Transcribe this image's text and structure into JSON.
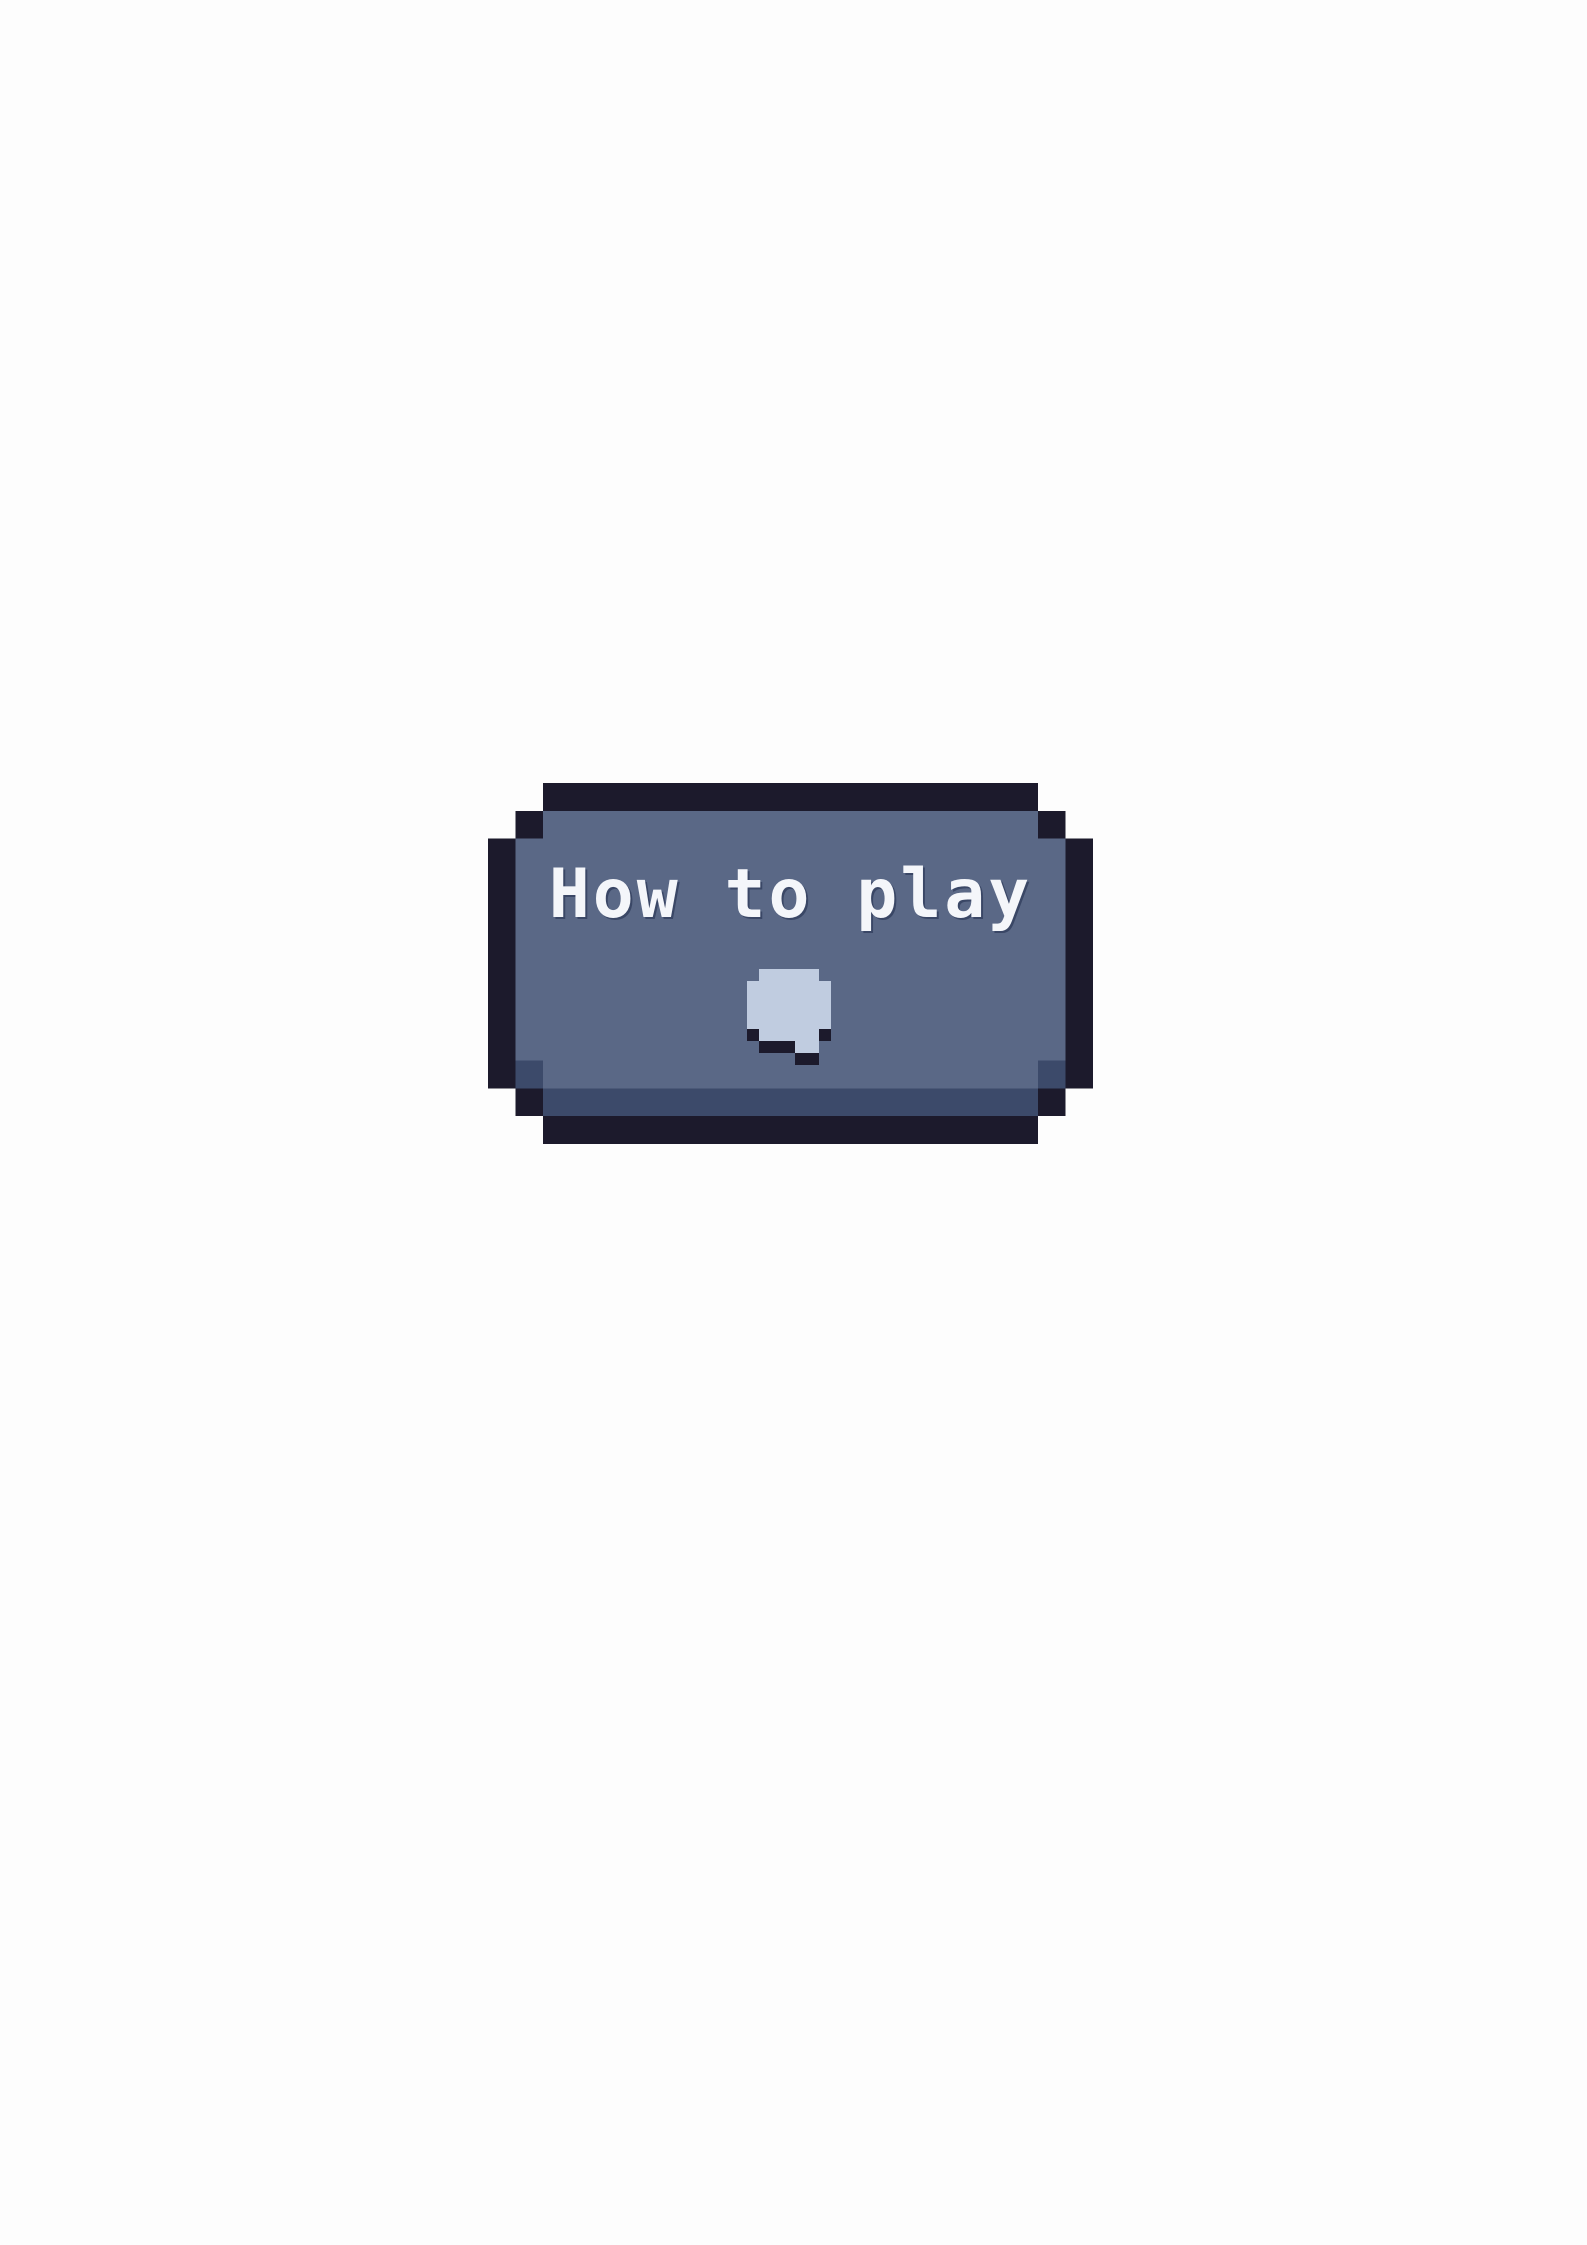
{
  "button": {
    "label": "How to play",
    "icon": "speech-bubble-icon"
  },
  "colors": {
    "page_background": "#fdfdfd",
    "outline": "#1c1a2c",
    "face": "#5a6886",
    "shadow": "#3c4a6a",
    "label": "#f4f6fa",
    "icon_fill": "#c0cce0"
  }
}
